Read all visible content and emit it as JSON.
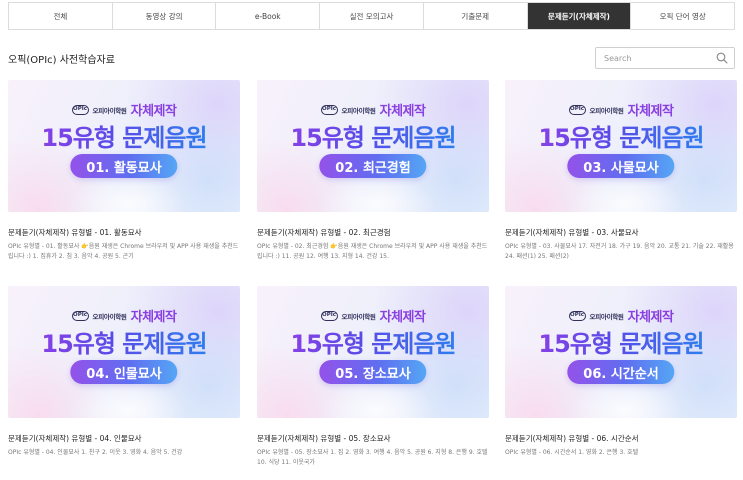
{
  "tabs": [
    {
      "label": "전체",
      "active": false
    },
    {
      "label": "동영상 강의",
      "active": false
    },
    {
      "label": "e-Book",
      "active": false
    },
    {
      "label": "실전 모의고사",
      "active": false
    },
    {
      "label": "기출문제",
      "active": false
    },
    {
      "label": "문제듣기(자체제작)",
      "active": true
    },
    {
      "label": "오픽 단어 영상",
      "active": false
    }
  ],
  "page_title": "오픽(OPIc) 사전학습자료",
  "search": {
    "placeholder": "Search",
    "icon": "search-icon"
  },
  "thumbnail": {
    "logo_badge": "OPIc",
    "academy": "오피아이학원",
    "own_production": "자체제작",
    "headline": "15유형 문제음원"
  },
  "cards": [
    {
      "pill": "01. 활동묘사",
      "title": "문제듣기(자체제작)  유형별 - 01. 활동묘사",
      "desc": "OPIc 유형별 - 01. 활동묘사 👉음원 재생은 Chrome 브라우저 및 APP 사용 재생을 추천드립니다 :) 1. 집휴가 2. 침 3. 음악 4. 공원 5. 곤기"
    },
    {
      "pill": "02. 최근경험",
      "title": "문제듣기(자체제작)  유형별 - 02. 최근경험",
      "desc": "OPIc 유형별 - 02. 최근경험 👉음원 재생은 Chrome 브라우저 및 APP 사용 재생을 추천드립니다 :) 11. 공원 12. 여행 13. 지형 14. 건강 15."
    },
    {
      "pill": "03. 사물묘사",
      "title": "문제듣기(자체제작)  유형별 - 03. 사물묘사",
      "desc": "OPIc 유형별 - 03. 사물묘사 17. 자전거 18. 가구 19. 음악 20. 교통 21. 기술 22. 재활용 24. 패션(1) 25. 패션(2)"
    },
    {
      "pill": "04. 인물묘사",
      "title": "문제듣기(자체제작)  유형별 - 04. 인물묘사",
      "desc": "OPIc 유형별 - 04. 인물묘사 1. 친구 2. 이웃 3. 영화 4. 음악 5. 건강"
    },
    {
      "pill": "05. 장소묘사",
      "title": "문제듣기(자체제작)  유형별 - 05. 장소묘사",
      "desc": "OPIc 유형별 - 05. 장소묘사 1. 집 2. 영화 3. 여행 4. 음악 5. 공원 6. 지형 8. 은행 9. 호텔 10. 식당 11. 이웃국가"
    },
    {
      "pill": "06. 시간순서",
      "title": "문제듣기(자체제작)  유형별 - 06. 시간순서",
      "desc": "OPIc 유형별 - 06. 시간순서 1. 영화 2. 은행 3. 호텔"
    }
  ]
}
